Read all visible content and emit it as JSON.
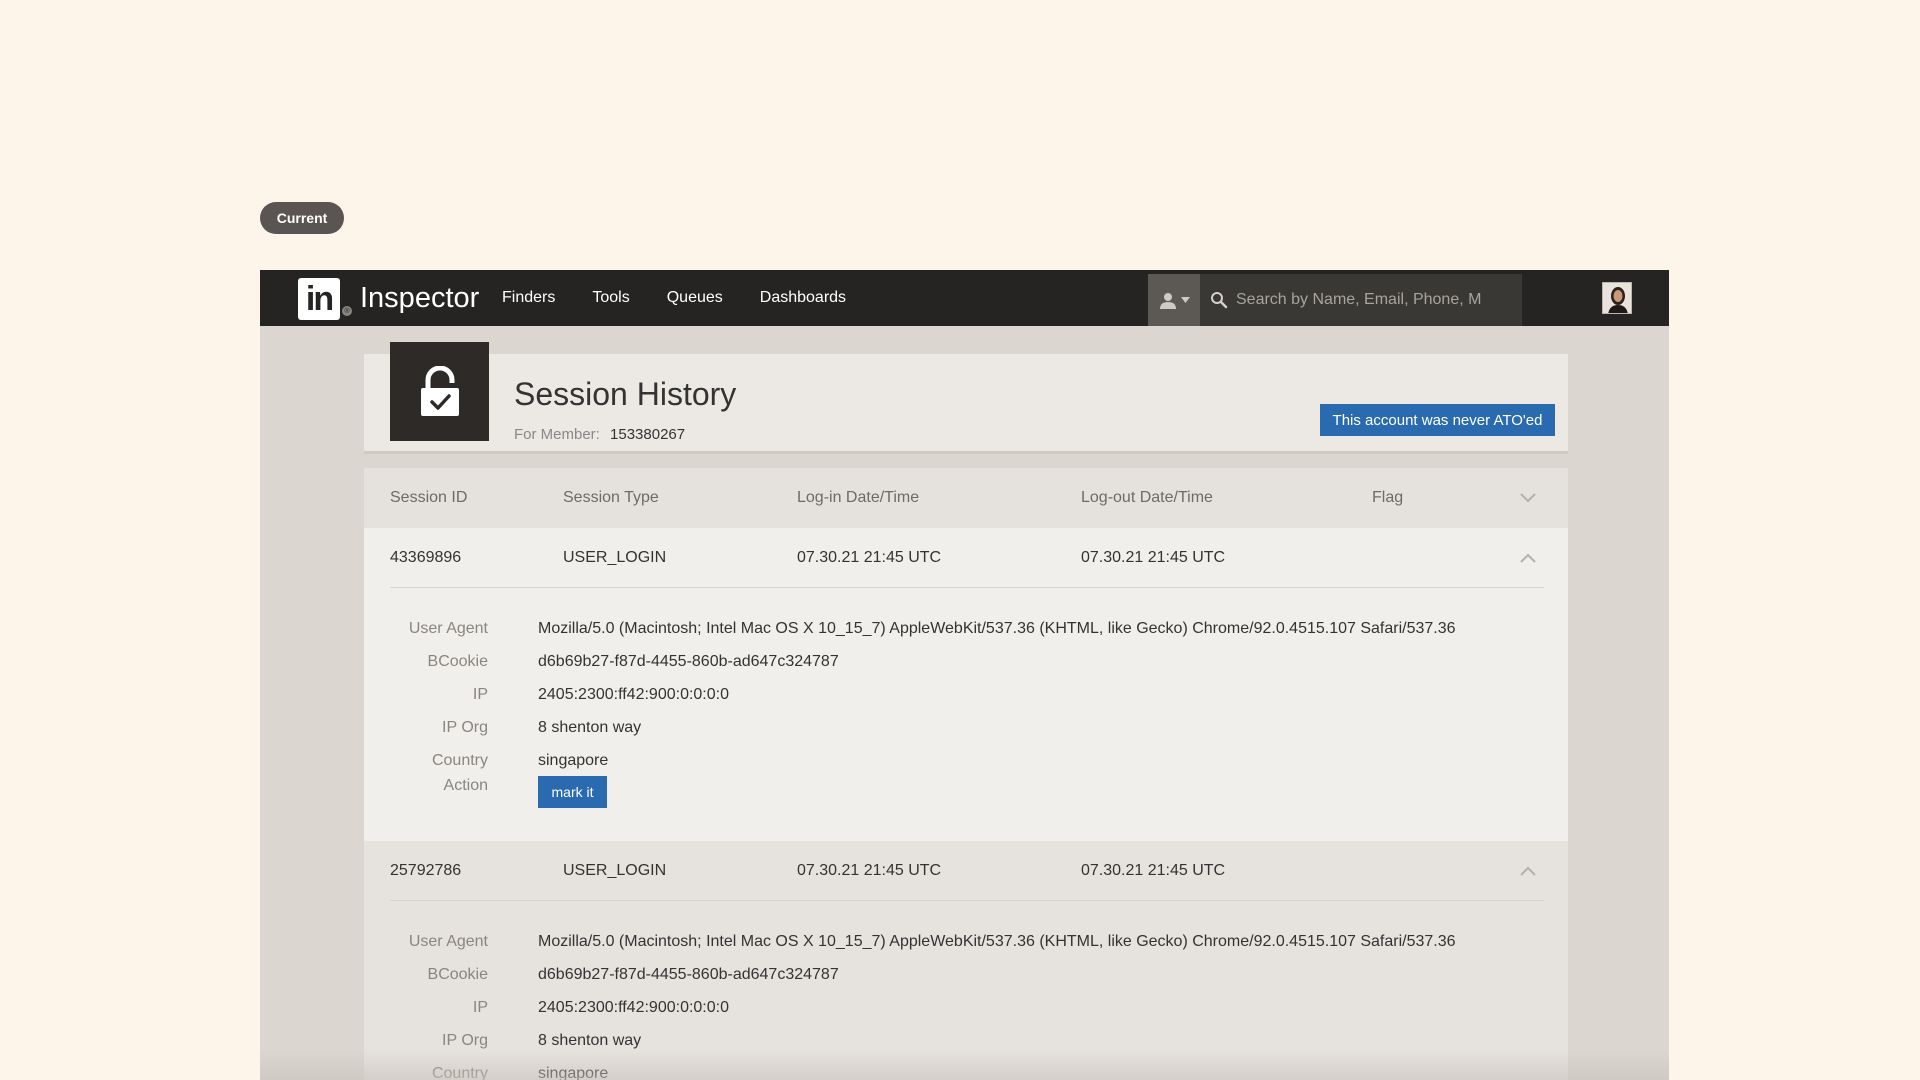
{
  "pill": {
    "label": "Current"
  },
  "topbar": {
    "logo_text": "in",
    "app_title": "Inspector",
    "nav": [
      "Finders",
      "Tools",
      "Queues",
      "Dashboards"
    ],
    "search_placeholder": "Search by Name, Email, Phone, M"
  },
  "header": {
    "title": "Session History",
    "member_label": "For Member:",
    "member_id": "153380267",
    "ato_badge": "This account was never ATO'ed"
  },
  "table": {
    "columns": [
      "Session ID",
      "Session Type",
      "Log-in Date/Time",
      "Log-out Date/Time",
      "Flag"
    ],
    "detail_labels": {
      "user_agent": "User Agent",
      "bcookie": "BCookie",
      "ip": "IP",
      "ip_org": "IP Org",
      "country": "Country",
      "action": "Action"
    },
    "action_button": "mark it",
    "rows": [
      {
        "session_id": "43369896",
        "session_type": "USER_LOGIN",
        "login": "07.30.21 21:45 UTC",
        "logout": "07.30.21 21:45 UTC",
        "user_agent": "Mozilla/5.0 (Macintosh; Intel Mac OS X 10_15_7) AppleWebKit/537.36 (KHTML, like Gecko) Chrome/92.0.4515.107 Safari/537.36",
        "bcookie": "d6b69b27-f87d-4455-860b-ad647c324787",
        "ip": "2405:2300:ff42:900:0:0:0:0",
        "ip_org": "8 shenton way",
        "country": "singapore"
      },
      {
        "session_id": "25792786",
        "session_type": "USER_LOGIN",
        "login": "07.30.21 21:45 UTC",
        "logout": "07.30.21 21:45 UTC",
        "user_agent": "Mozilla/5.0 (Macintosh; Intel Mac OS X 10_15_7) AppleWebKit/537.36 (KHTML, like Gecko) Chrome/92.0.4515.107 Safari/537.36",
        "bcookie": "d6b69b27-f87d-4455-860b-ad647c324787",
        "ip": "2405:2300:ff42:900:0:0:0:0",
        "ip_org": "8 shenton way",
        "country": "singapore"
      }
    ]
  },
  "colors": {
    "page_bg": "#fdf4ea",
    "topbar": "#262422",
    "accent_blue": "#2a6bb0"
  }
}
